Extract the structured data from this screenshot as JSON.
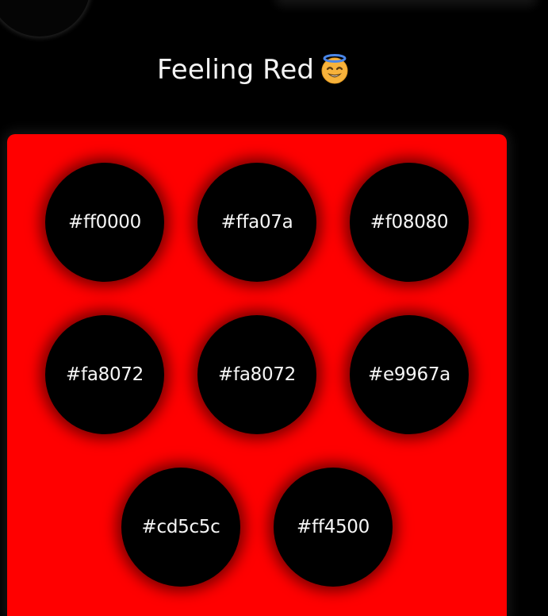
{
  "header": {
    "title": "Feeling Red",
    "emoji_icon": "smiling-face-with-halo"
  },
  "palette": {
    "background_color": "#ff0000",
    "swatches": [
      {
        "label": "#ff0000"
      },
      {
        "label": "#ffa07a"
      },
      {
        "label": "#f08080"
      },
      {
        "label": "#fa8072"
      },
      {
        "label": "#fa8072"
      },
      {
        "label": "#e9967a"
      },
      {
        "label": "#cd5c5c"
      },
      {
        "label": "#ff4500"
      }
    ]
  },
  "colors": {
    "page_background": "#000000",
    "swatch_fill": "#000000",
    "text": "#f4f4f4"
  }
}
